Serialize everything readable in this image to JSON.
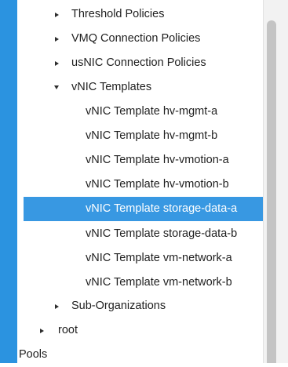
{
  "tree": {
    "threshold_policies": "Threshold Policies",
    "vmq_connection_policies": "VMQ Connection Policies",
    "usnic_connection_policies": "usNIC Connection Policies",
    "vnic_templates": "vNIC Templates",
    "templates": [
      "vNIC Template hv-mgmt-a",
      "vNIC Template hv-mgmt-b",
      "vNIC Template hv-vmotion-a",
      "vNIC Template hv-vmotion-b",
      "vNIC Template storage-data-a",
      "vNIC Template storage-data-b",
      "vNIC Template vm-network-a",
      "vNIC Template vm-network-b"
    ],
    "selected_template": "vNIC Template storage-data-a",
    "sub_organizations": "Sub-Organizations",
    "root": "root",
    "pools": "Pools"
  },
  "colors": {
    "left_rail": "#2b93e0",
    "selection": "#3898e2",
    "scrollbar_thumb": "#c4c4c4"
  },
  "icons": {
    "collapsed": "triangle-right-icon",
    "expanded": "triangle-down-icon"
  }
}
